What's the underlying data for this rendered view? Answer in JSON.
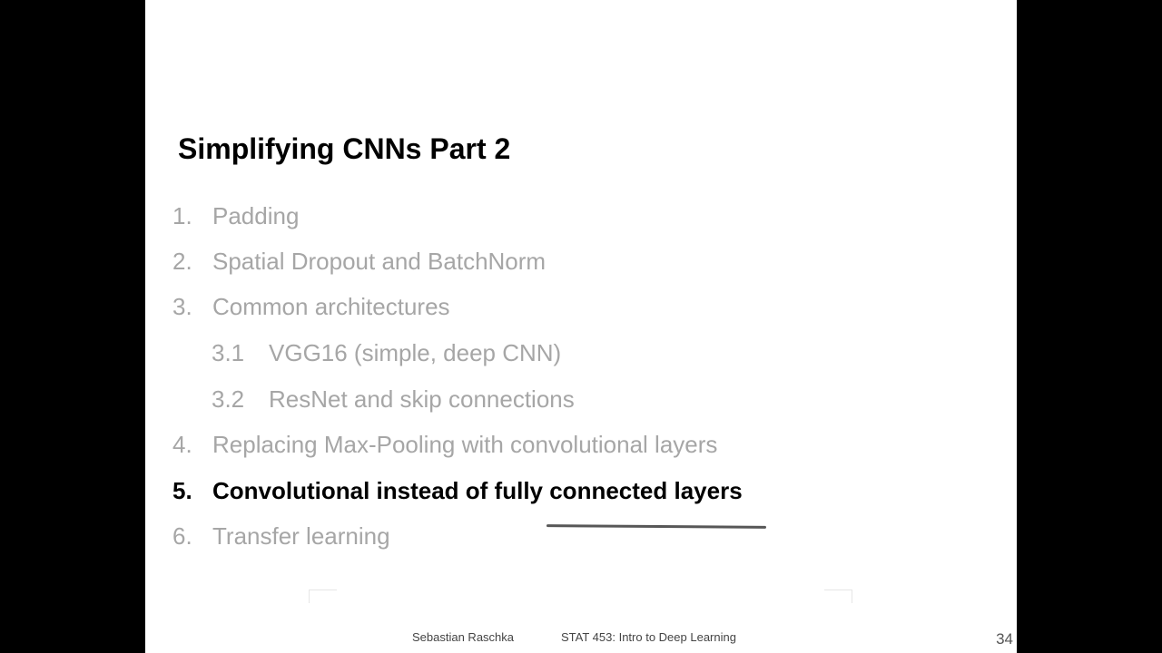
{
  "slide": {
    "title": "Simplifying CNNs Part 2",
    "outline": [
      {
        "number": "1.",
        "label": "Padding",
        "active": false
      },
      {
        "number": "2.",
        "label": "Spatial Dropout and BatchNorm",
        "active": false
      },
      {
        "number": "3.",
        "label": "Common architectures",
        "active": false
      },
      {
        "number": "3.1",
        "label": "VGG16 (simple, deep CNN)",
        "active": false
      },
      {
        "number": "3.2",
        "label": "ResNet and skip connections",
        "active": false
      },
      {
        "number": "4.",
        "label": "Replacing Max-Pooling with convolutional layers",
        "active": false
      },
      {
        "number": "5.",
        "label": "Convolutional instead of fully connected layers",
        "active": true
      },
      {
        "number": "6.",
        "label": "Transfer learning",
        "active": false
      }
    ],
    "footer": {
      "author": "Sebastian Raschka",
      "course": "STAT 453: Intro to Deep Learning",
      "page_number": "34"
    }
  },
  "colors": {
    "active_text": "#000000",
    "inactive_text": "#a6a6a6",
    "background": "#ffffff",
    "letterbox": "#000000"
  }
}
